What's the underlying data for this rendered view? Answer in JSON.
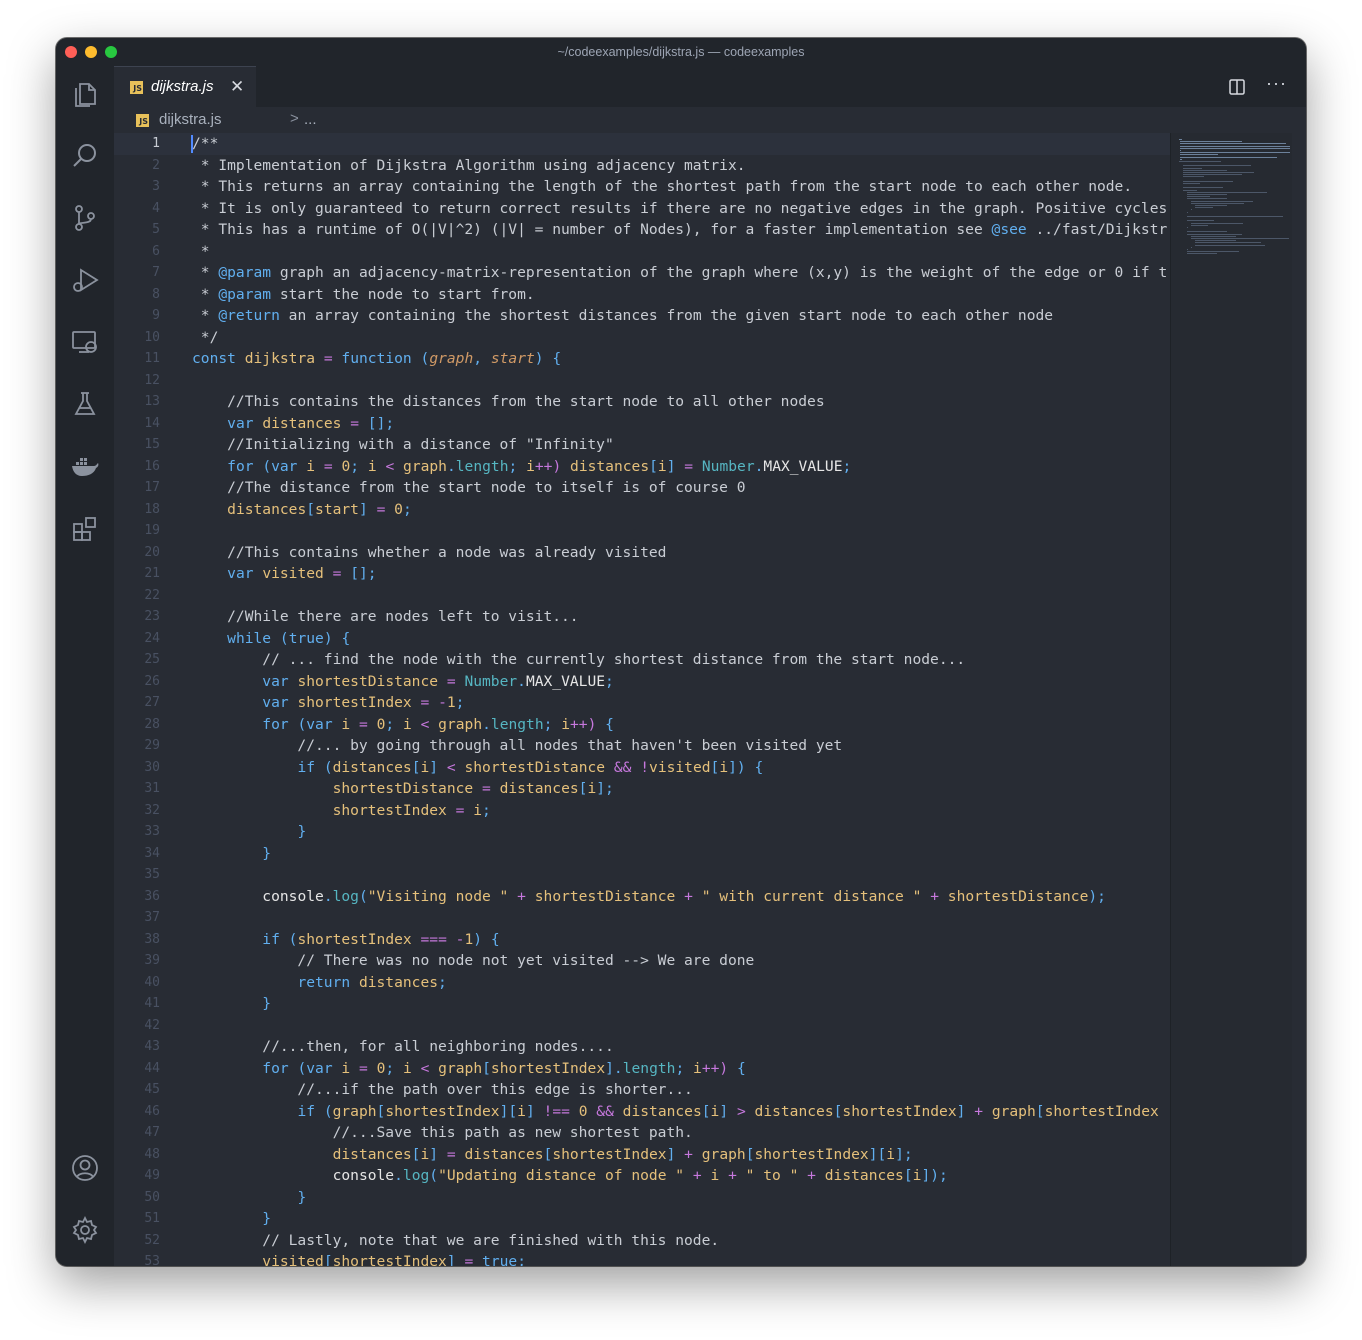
{
  "window": {
    "title": "~/codeexamples/dijkstra.js — codeexamples"
  },
  "activity_bar": {
    "items": [
      "explorer-icon",
      "search-icon",
      "source-control-icon",
      "run-debug-icon",
      "remote-explorer-icon",
      "testing-icon",
      "docker-icon",
      "extensions-icon"
    ],
    "bottom": [
      "accounts-icon",
      "settings-gear-icon"
    ]
  },
  "tabs": [
    {
      "label": "dijkstra.js",
      "badge": "JS",
      "active": true
    }
  ],
  "breadcrumb": {
    "file": "dijkstra.js",
    "separator": ">",
    "more": "..."
  },
  "editor": {
    "current_line": 1,
    "lines": [
      "/**",
      " * Implementation of Dijkstra Algorithm using adjacency matrix.",
      " * This returns an array containing the length of the shortest path from the start node to each other node.",
      " * It is only guaranteed to return correct results if there are no negative edges in the graph. Positive cycles",
      " * This has a runtime of O(|V|^2) (|V| = number of Nodes), for a faster implementation see @see ../fast/Dijkstr",
      " *",
      " * @param graph an adjacency-matrix-representation of the graph where (x,y) is the weight of the edge or 0 if t",
      " * @param start the node to start from.",
      " * @return an array containing the shortest distances from the given start node to each other node",
      " */",
      "const dijkstra = function (graph, start) {",
      "",
      "    //This contains the distances from the start node to all other nodes",
      "    var distances = [];",
      "    //Initializing with a distance of \"Infinity\"",
      "    for (var i = 0; i < graph.length; i++) distances[i] = Number.MAX_VALUE;",
      "    //The distance from the start node to itself is of course 0",
      "    distances[start] = 0;",
      "",
      "    //This contains whether a node was already visited",
      "    var visited = [];",
      "",
      "    //While there are nodes left to visit...",
      "    while (true) {",
      "        // ... find the node with the currently shortest distance from the start node...",
      "        var shortestDistance = Number.MAX_VALUE;",
      "        var shortestIndex = -1;",
      "        for (var i = 0; i < graph.length; i++) {",
      "            //... by going through all nodes that haven't been visited yet",
      "            if (distances[i] < shortestDistance && !visited[i]) {",
      "                shortestDistance = distances[i];",
      "                shortestIndex = i;",
      "            }",
      "        }",
      "",
      "        console.log(\"Visiting node \" + shortestDistance + \" with current distance \" + shortestDistance);",
      "",
      "        if (shortestIndex === -1) {",
      "            // There was no node not yet visited --> We are done",
      "            return distances;",
      "        }",
      "",
      "        //...then, for all neighboring nodes....",
      "        for (var i = 0; i < graph[shortestIndex].length; i++) {",
      "            //...if the path over this edge is shorter...",
      "            if (graph[shortestIndex][i] !== 0 && distances[i] > distances[shortestIndex] + graph[shortestIndex",
      "                //...Save this path as new shortest path.",
      "                distances[i] = distances[shortestIndex] + graph[shortestIndex][i];",
      "                console.log(\"Updating distance of node \" + i + \" to \" + distances[i]);",
      "            }",
      "        }",
      "        // Lastly, note that we are finished with this node.",
      "        visited[shortestIndex] = true;"
    ]
  },
  "theme": {
    "background": "#282c34",
    "sidebar": "#21252b",
    "accent": "#528bff"
  }
}
